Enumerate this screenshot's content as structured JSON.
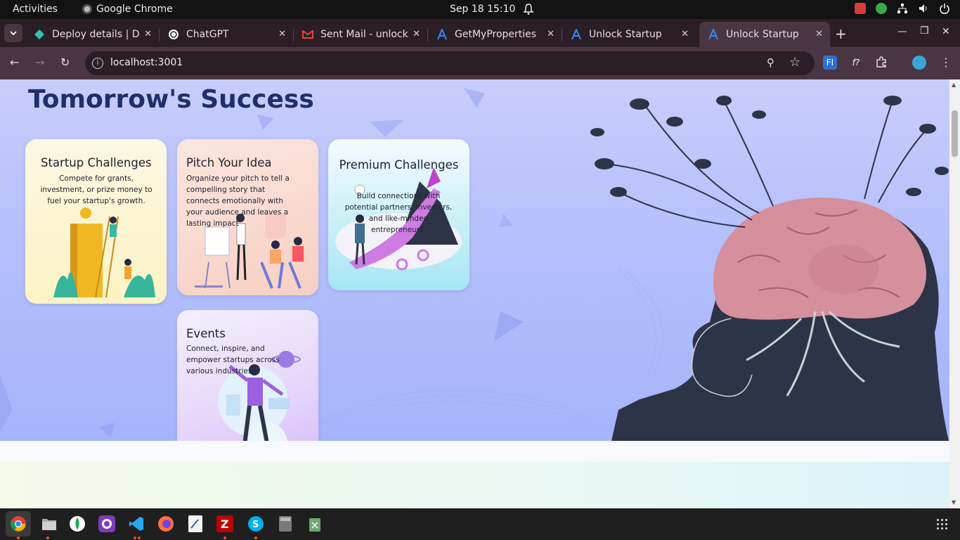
{
  "topbar": {
    "activities": "Activities",
    "app_name": "Google Chrome",
    "clock": "Sep 18  15:10"
  },
  "tabs": [
    {
      "title": "Deploy details | D",
      "icon": "netlify-icon"
    },
    {
      "title": "ChatGPT",
      "icon": "chatgpt-icon"
    },
    {
      "title": "Sent Mail - unlock",
      "icon": "gmail-icon"
    },
    {
      "title": "GetMyProperties",
      "icon": "a-logo-icon"
    },
    {
      "title": "Unlock Startup",
      "icon": "a-logo-icon"
    },
    {
      "title": "Unlock Startup",
      "icon": "a-logo-icon",
      "active": true
    }
  ],
  "address": {
    "url": "localhost:3001"
  },
  "hero": {
    "heading_line2": "Tomorrow's Success",
    "cards": [
      {
        "title": "Startup Challenges",
        "text": "Compete for grants, investment, or prize money to fuel your startup's growth."
      },
      {
        "title": "Pitch Your Idea",
        "text": "Organize your pitch to tell a compelling story that connects emotionally with your audience and leaves a lasting impact"
      },
      {
        "title": "Premium Challenges",
        "text": "Build connections with potential partners, investors, and like-minded entrepreneurs."
      },
      {
        "title": "Events",
        "text": "Connect, inspire, and empower startups across various industries."
      }
    ]
  },
  "colors": {
    "hero_heading": "#1f2f6b",
    "chrome_frame": "#2b1e27",
    "chrome_toolbar": "#4a3543"
  }
}
